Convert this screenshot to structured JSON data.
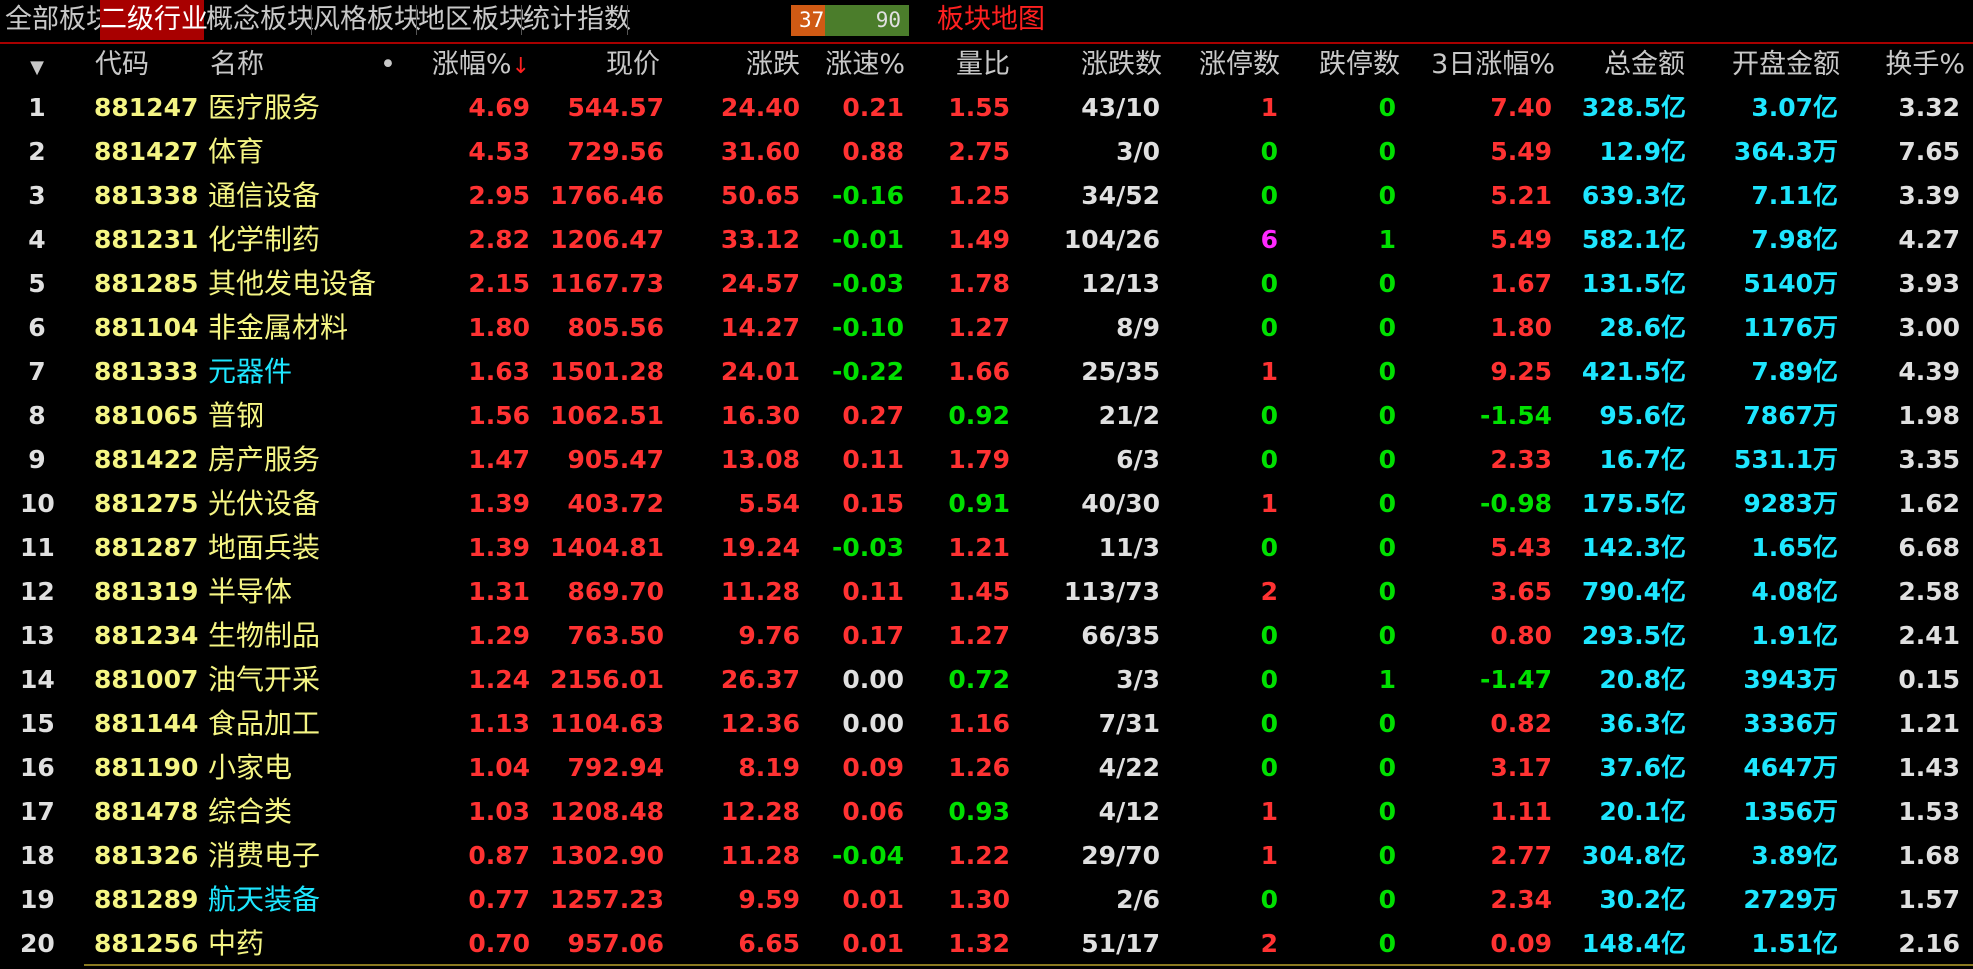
{
  "tabs": [
    {
      "label": "全部板块",
      "active": false
    },
    {
      "label": "二级行业",
      "active": true
    },
    {
      "label": "概念板块",
      "active": false
    },
    {
      "label": "风格板块",
      "active": false
    },
    {
      "label": "地区板块",
      "active": false
    },
    {
      "label": "统计指数",
      "active": false
    }
  ],
  "adv_dec": {
    "advancing": "37",
    "declining": "90",
    "advancing_fraction": 0.29
  },
  "sector_map_label": "板块地图",
  "header": {
    "menu_icon": "triangle-down-icon",
    "code": "代码",
    "name": "名称",
    "dot": "•",
    "change_pct": "涨幅%",
    "sort_arrow": "↓",
    "price": "现价",
    "change": "涨跌",
    "speed": "涨速%",
    "vol_ratio": "量比",
    "up_down": "涨跌数",
    "limit_up": "涨停数",
    "limit_down": "跌停数",
    "change_3d": "3日涨幅%",
    "amount": "总金额",
    "open_amount": "开盘金额",
    "turnover": "换手%"
  },
  "colors": {
    "up": "#ff3232",
    "down": "#00e000",
    "flat": "#e0e0e0",
    "code": "#f5f584",
    "amount": "#1ee6ff",
    "limit_highlight": "#ff28ff",
    "active_tab": "#a80000"
  },
  "rows": [
    {
      "idx": "1",
      "code": "881247",
      "name": "医疗服务",
      "name_color": "yellow",
      "pct": "4.69",
      "price": "544.57",
      "chg": "24.40",
      "speed": "0.21",
      "vr": "1.55",
      "ud": "43/10",
      "lu": "1",
      "ld": "0",
      "d3": "7.40",
      "amt": "328.5亿",
      "open": "3.07亿",
      "to": "3.32"
    },
    {
      "idx": "2",
      "code": "881427",
      "name": "体育",
      "name_color": "yellow",
      "pct": "4.53",
      "price": "729.56",
      "chg": "31.60",
      "speed": "0.88",
      "vr": "2.75",
      "ud": "3/0",
      "lu": "0",
      "ld": "0",
      "d3": "5.49",
      "amt": "12.9亿",
      "open": "364.3万",
      "to": "7.65"
    },
    {
      "idx": "3",
      "code": "881338",
      "name": "通信设备",
      "name_color": "yellow",
      "pct": "2.95",
      "price": "1766.46",
      "chg": "50.65",
      "speed": "-0.16",
      "vr": "1.25",
      "ud": "34/52",
      "lu": "0",
      "ld": "0",
      "d3": "5.21",
      "amt": "639.3亿",
      "open": "7.11亿",
      "to": "3.39"
    },
    {
      "idx": "4",
      "code": "881231",
      "name": "化学制药",
      "name_color": "yellow",
      "pct": "2.82",
      "price": "1206.47",
      "chg": "33.12",
      "speed": "-0.01",
      "vr": "1.49",
      "ud": "104/26",
      "lu": "6",
      "ld": "1",
      "d3": "5.49",
      "amt": "582.1亿",
      "open": "7.98亿",
      "to": "4.27"
    },
    {
      "idx": "5",
      "code": "881285",
      "name": "其他发电设备",
      "name_color": "yellow",
      "pct": "2.15",
      "price": "1167.73",
      "chg": "24.57",
      "speed": "-0.03",
      "vr": "1.78",
      "ud": "12/13",
      "lu": "0",
      "ld": "0",
      "d3": "1.67",
      "amt": "131.5亿",
      "open": "5140万",
      "to": "3.93"
    },
    {
      "idx": "6",
      "code": "881104",
      "name": "非金属材料",
      "name_color": "yellow",
      "pct": "1.80",
      "price": "805.56",
      "chg": "14.27",
      "speed": "-0.10",
      "vr": "1.27",
      "ud": "8/9",
      "lu": "0",
      "ld": "0",
      "d3": "1.80",
      "amt": "28.6亿",
      "open": "1176万",
      "to": "3.00"
    },
    {
      "idx": "7",
      "code": "881333",
      "name": "元器件",
      "name_color": "cyan",
      "pct": "1.63",
      "price": "1501.28",
      "chg": "24.01",
      "speed": "-0.22",
      "vr": "1.66",
      "ud": "25/35",
      "lu": "1",
      "ld": "0",
      "d3": "9.25",
      "amt": "421.5亿",
      "open": "7.89亿",
      "to": "4.39"
    },
    {
      "idx": "8",
      "code": "881065",
      "name": "普钢",
      "name_color": "yellow",
      "pct": "1.56",
      "price": "1062.51",
      "chg": "16.30",
      "speed": "0.27",
      "vr": "0.92",
      "ud": "21/2",
      "lu": "0",
      "ld": "0",
      "d3": "-1.54",
      "amt": "95.6亿",
      "open": "7867万",
      "to": "1.98"
    },
    {
      "idx": "9",
      "code": "881422",
      "name": "房产服务",
      "name_color": "yellow",
      "pct": "1.47",
      "price": "905.47",
      "chg": "13.08",
      "speed": "0.11",
      "vr": "1.79",
      "ud": "6/3",
      "lu": "0",
      "ld": "0",
      "d3": "2.33",
      "amt": "16.7亿",
      "open": "531.1万",
      "to": "3.35"
    },
    {
      "idx": "10",
      "code": "881275",
      "name": "光伏设备",
      "name_color": "yellow",
      "pct": "1.39",
      "price": "403.72",
      "chg": "5.54",
      "speed": "0.15",
      "vr": "0.91",
      "ud": "40/30",
      "lu": "1",
      "ld": "0",
      "d3": "-0.98",
      "amt": "175.5亿",
      "open": "9283万",
      "to": "1.62"
    },
    {
      "idx": "11",
      "code": "881287",
      "name": "地面兵装",
      "name_color": "yellow",
      "pct": "1.39",
      "price": "1404.81",
      "chg": "19.24",
      "speed": "-0.03",
      "vr": "1.21",
      "ud": "11/3",
      "lu": "0",
      "ld": "0",
      "d3": "5.43",
      "amt": "142.3亿",
      "open": "1.65亿",
      "to": "6.68"
    },
    {
      "idx": "12",
      "code": "881319",
      "name": "半导体",
      "name_color": "yellow",
      "pct": "1.31",
      "price": "869.70",
      "chg": "11.28",
      "speed": "0.11",
      "vr": "1.45",
      "ud": "113/73",
      "lu": "2",
      "ld": "0",
      "d3": "3.65",
      "amt": "790.4亿",
      "open": "4.08亿",
      "to": "2.58"
    },
    {
      "idx": "13",
      "code": "881234",
      "name": "生物制品",
      "name_color": "yellow",
      "pct": "1.29",
      "price": "763.50",
      "chg": "9.76",
      "speed": "0.17",
      "vr": "1.27",
      "ud": "66/35",
      "lu": "0",
      "ld": "0",
      "d3": "0.80",
      "amt": "293.5亿",
      "open": "1.91亿",
      "to": "2.41"
    },
    {
      "idx": "14",
      "code": "881007",
      "name": "油气开采",
      "name_color": "yellow",
      "pct": "1.24",
      "price": "2156.01",
      "chg": "26.37",
      "speed": "0.00",
      "vr": "0.72",
      "ud": "3/3",
      "lu": "0",
      "ld": "1",
      "d3": "-1.47",
      "amt": "20.8亿",
      "open": "3943万",
      "to": "0.15"
    },
    {
      "idx": "15",
      "code": "881144",
      "name": "食品加工",
      "name_color": "yellow",
      "pct": "1.13",
      "price": "1104.63",
      "chg": "12.36",
      "speed": "0.00",
      "vr": "1.16",
      "ud": "7/31",
      "lu": "0",
      "ld": "0",
      "d3": "0.82",
      "amt": "36.3亿",
      "open": "3336万",
      "to": "1.21"
    },
    {
      "idx": "16",
      "code": "881190",
      "name": "小家电",
      "name_color": "yellow",
      "pct": "1.04",
      "price": "792.94",
      "chg": "8.19",
      "speed": "0.09",
      "vr": "1.26",
      "ud": "4/22",
      "lu": "0",
      "ld": "0",
      "d3": "3.17",
      "amt": "37.6亿",
      "open": "4647万",
      "to": "1.43"
    },
    {
      "idx": "17",
      "code": "881478",
      "name": "综合类",
      "name_color": "yellow",
      "pct": "1.03",
      "price": "1208.48",
      "chg": "12.28",
      "speed": "0.06",
      "vr": "0.93",
      "ud": "4/12",
      "lu": "1",
      "ld": "0",
      "d3": "1.11",
      "amt": "20.1亿",
      "open": "1356万",
      "to": "1.53"
    },
    {
      "idx": "18",
      "code": "881326",
      "name": "消费电子",
      "name_color": "yellow",
      "pct": "0.87",
      "price": "1302.90",
      "chg": "11.28",
      "speed": "-0.04",
      "vr": "1.22",
      "ud": "29/70",
      "lu": "1",
      "ld": "0",
      "d3": "2.77",
      "amt": "304.8亿",
      "open": "3.89亿",
      "to": "1.68"
    },
    {
      "idx": "19",
      "code": "881289",
      "name": "航天装备",
      "name_color": "cyan",
      "pct": "0.77",
      "price": "1257.23",
      "chg": "9.59",
      "speed": "0.01",
      "vr": "1.30",
      "ud": "2/6",
      "lu": "0",
      "ld": "0",
      "d3": "2.34",
      "amt": "30.2亿",
      "open": "2729万",
      "to": "1.57"
    },
    {
      "idx": "20",
      "code": "881256",
      "name": "中药",
      "name_color": "yellow",
      "pct": "0.70",
      "price": "957.06",
      "chg": "6.65",
      "speed": "0.01",
      "vr": "1.32",
      "ud": "51/17",
      "lu": "2",
      "ld": "0",
      "d3": "0.09",
      "amt": "148.4亿",
      "open": "1.51亿",
      "to": "2.16"
    }
  ]
}
